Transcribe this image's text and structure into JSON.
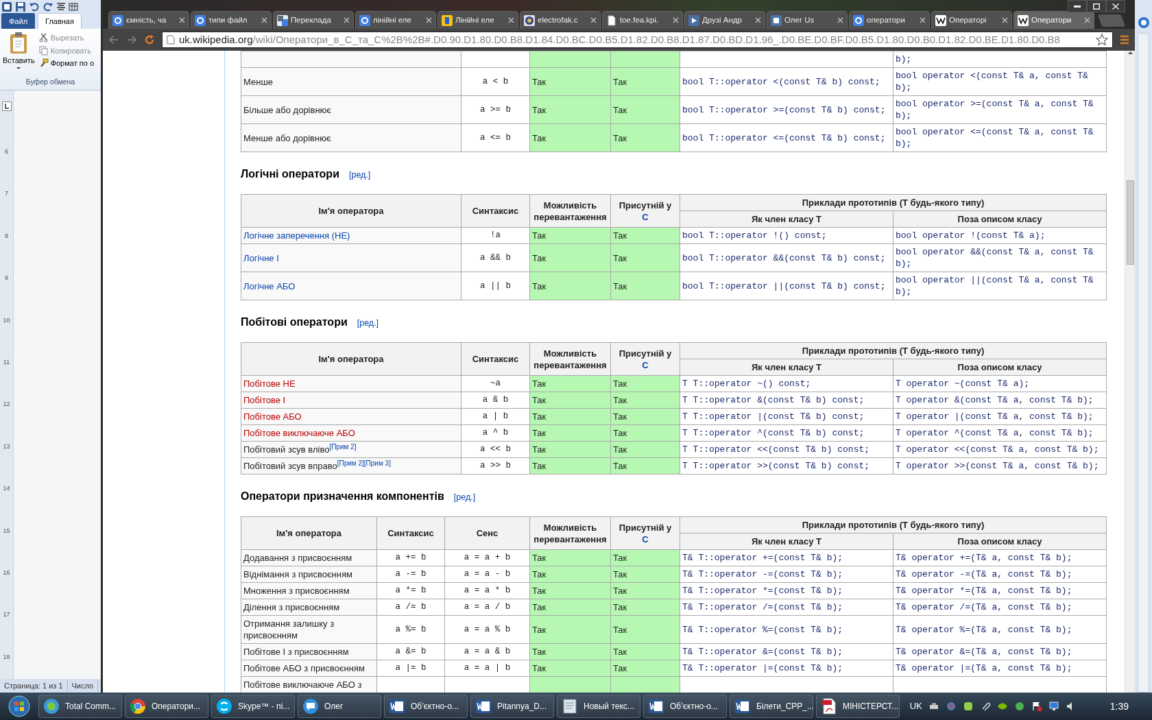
{
  "word": {
    "tabs": [
      {
        "label": "Файл",
        "kind": "file",
        "selected": false
      },
      {
        "label": "Главная",
        "kind": "tab",
        "selected": true
      }
    ],
    "clipboard": {
      "paste": "Вставить",
      "group": "Буфер обмена",
      "items": [
        {
          "label": "Вырезать",
          "kind": "cut",
          "disabled": true
        },
        {
          "label": "Копировать",
          "kind": "copy",
          "disabled": true
        },
        {
          "label": "Формат по о",
          "kind": "format",
          "disabled": false
        }
      ]
    },
    "ruler": [
      "6",
      "7",
      "8",
      "9",
      "10",
      "11",
      "12",
      "13",
      "14",
      "15",
      "16",
      "17",
      "18"
    ],
    "status_bar": [
      "Страница: 1 из 1",
      "Число"
    ]
  },
  "browser": {
    "tabs": [
      {
        "title": "ємність, ча",
        "selected": false
      },
      {
        "title": "типи файл",
        "selected": false
      },
      {
        "title": "Переклада",
        "selected": false
      },
      {
        "title": "лінійні еле",
        "selected": false
      },
      {
        "title": "Лінійні еле",
        "selected": false
      },
      {
        "title": "electrofak.c",
        "selected": false
      },
      {
        "title": "toe.fea.kpi.",
        "selected": false
      },
      {
        "title": "Друзі Андр",
        "selected": false
      },
      {
        "title": "Олег Us",
        "selected": false
      },
      {
        "title": "оператори",
        "selected": false
      },
      {
        "title": "Операторі",
        "selected": false
      },
      {
        "title": "Оператори",
        "selected": true
      }
    ],
    "address": {
      "host": "uk.wikipedia.org",
      "path": "/wiki/Оператори_в_C_та_C%2B%2B#.D0.90.D1.80.D0.B8.D1.84.D0.BC.D0.B5.D1.82.D0.B8.D1.87.D0.BD.D1.96_.D0.BE.D0.BF.D0.B5.D1.80.D0.B0.D1.82.D0.BE.D1.80.D0.B8"
    }
  },
  "page": {
    "sections": [
      {
        "rows": [
          {
            "nonmember": "b);"
          },
          {
            "name": {
              "text": "Менше",
              "kind": "text"
            },
            "syntax": "a < b",
            "overload": "Так",
            "in_c": "Так",
            "member": "bool T::operator <(const T& b) const;",
            "nonmember": "bool operator <(const T& a, const T& b);"
          },
          {
            "name": {
              "text": "Більше або дорівнює",
              "kind": "text"
            },
            "syntax": "a >= b",
            "overload": "Так",
            "in_c": "Так",
            "member": "bool T::operator >=(const T& b) const;",
            "nonmember": "bool operator >=(const T& a, const T& b);"
          },
          {
            "name": {
              "text": "Менше або дорівнює",
              "kind": "text"
            },
            "syntax": "a <= b",
            "overload": "Так",
            "in_c": "Так",
            "member": "bool T::operator <=(const T& b) const;",
            "nonmember": "bool operator <=(const T& a, const T& b);"
          }
        ]
      },
      {
        "heading": "Логічні оператори",
        "edit": "[ред.]",
        "header": {
          "name": "Ім'я оператора",
          "syntax": "Синтаксис",
          "overload": "Можливість перевантаження",
          "in_c": "Присутній у",
          "in_c_link": "C",
          "group": "Приклади прототипів (T будь-якого типу)",
          "member": "Як член класу T",
          "nonmember": "Поза описом класу"
        },
        "rows": [
          {
            "name": {
              "text": "Логічне заперечення (НЕ)",
              "kind": "link"
            },
            "syntax": "!a",
            "overload": "Так",
            "in_c": "Так",
            "member": "bool T::operator !() const;",
            "nonmember": "bool operator !(const T& a);"
          },
          {
            "name": {
              "text": "Логічне І",
              "kind": "link"
            },
            "syntax": "a && b",
            "overload": "Так",
            "in_c": "Так",
            "member": "bool T::operator &&(const T& b) const;",
            "nonmember": "bool operator &&(const T& a, const T& b);"
          },
          {
            "name": {
              "text": "Логічне АБО",
              "kind": "link"
            },
            "syntax": "a || b",
            "overload": "Так",
            "in_c": "Так",
            "member": "bool T::operator ||(const T& b) const;",
            "nonmember": "bool operator ||(const T& a, const T& b);"
          }
        ]
      },
      {
        "heading": "Побітові оператори",
        "edit": "[ред.]",
        "header": {
          "name": "Ім'я оператора",
          "syntax": "Синтаксис",
          "overload": "Можливість перевантаження",
          "in_c": "Присутній у",
          "in_c_link": "C",
          "group": "Приклади прототипів (T будь-якого типу)",
          "member": "Як член класу T",
          "nonmember": "Поза описом класу"
        },
        "rows": [
          {
            "name": {
              "text": "Побітове НЕ",
              "kind": "redlink"
            },
            "syntax": "~a",
            "overload": "Так",
            "in_c": "Так",
            "member": "T T::operator ~() const;",
            "nonmember": "T operator ~(const T& a);"
          },
          {
            "name": {
              "text": "Побітове І",
              "kind": "redlink"
            },
            "syntax": "a & b",
            "overload": "Так",
            "in_c": "Так",
            "member": "T T::operator &(const T& b) const;",
            "nonmember": "T operator &(const T& a, const T& b);"
          },
          {
            "name": {
              "text": "Побітове АБО",
              "kind": "redlink"
            },
            "syntax": "a | b",
            "overload": "Так",
            "in_c": "Так",
            "member": "T T::operator |(const T& b) const;",
            "nonmember": "T operator |(const T& a, const T& b);"
          },
          {
            "name": {
              "text": "Побітове виключаюче АБО",
              "kind": "redlink"
            },
            "syntax": "a ^ b",
            "overload": "Так",
            "in_c": "Так",
            "member": "T T::operator ^(const T& b) const;",
            "nonmember": "T operator ^(const T& a, const T& b);"
          },
          {
            "name": {
              "text": "Побітовий зсув вліво",
              "kind": "text",
              "notes": [
                "[Прим 2]"
              ]
            },
            "syntax": "a << b",
            "overload": "Так",
            "in_c": "Так",
            "member": "T T::operator <<(const T& b) const;",
            "nonmember": "T operator <<(const T& a, const T& b);"
          },
          {
            "name": {
              "text": "Побітовий зсув вправо",
              "kind": "text",
              "notes": [
                "[Прим 2]",
                "[Прим 3]"
              ]
            },
            "syntax": "a >> b",
            "overload": "Так",
            "in_c": "Так",
            "member": "T T::operator >>(const T& b) const;",
            "nonmember": "T operator >>(const T& a, const T& b);"
          }
        ]
      },
      {
        "heading": "Оператори призначення компонентів",
        "edit": "[ред.]",
        "header": {
          "name": "Ім'я оператора",
          "syntax": "Синтаксис",
          "sense": "Сенс",
          "overload": "Можливість перевантаження",
          "in_c": "Присутній у",
          "in_c_link": "C",
          "group": "Приклади прототипів (T будь-якого типу)",
          "member": "Як член класу T",
          "nonmember": "Поза описом класу"
        },
        "rows": [
          {
            "name": {
              "text": "Додавання з присвоєнням",
              "kind": "text"
            },
            "syntax": "a += b",
            "sense": "a = a + b",
            "overload": "Так",
            "in_c": "Так",
            "member": "T& T::operator +=(const T& b);",
            "nonmember": "T& operator +=(T& a, const T& b);"
          },
          {
            "name": {
              "text": "Віднімання з присвоєнням",
              "kind": "text"
            },
            "syntax": "a -= b",
            "sense": "a = a - b",
            "overload": "Так",
            "in_c": "Так",
            "member": "T& T::operator -=(const T& b);",
            "nonmember": "T& operator -=(T& a, const T& b);"
          },
          {
            "name": {
              "text": "Множення з присвоєнням",
              "kind": "text"
            },
            "syntax": "a *= b",
            "sense": "a = a * b",
            "overload": "Так",
            "in_c": "Так",
            "member": "T& T::operator *=(const T& b);",
            "nonmember": "T& operator *=(T& a, const T& b);"
          },
          {
            "name": {
              "text": "Ділення з присвоєнням",
              "kind": "text"
            },
            "syntax": "a /= b",
            "sense": "a = a / b",
            "overload": "Так",
            "in_c": "Так",
            "member": "T& T::operator /=(const T& b);",
            "nonmember": "T& operator /=(T& a, const T& b);"
          },
          {
            "name": {
              "text": "Отримання залишку з присвоєнням",
              "kind": "text"
            },
            "syntax": "a %= b",
            "sense": "a = a % b",
            "overload": "Так",
            "in_c": "Так",
            "member": "T& T::operator %=(const T& b);",
            "nonmember": "T& operator %=(T& a, const T& b);"
          },
          {
            "name": {
              "text": "Побітове І з присвоєнням",
              "kind": "text"
            },
            "syntax": "a &= b",
            "sense": "a = a & b",
            "overload": "Так",
            "in_c": "Так",
            "member": "T& T::operator &=(const T& b);",
            "nonmember": "T& operator &=(T& a, const T& b);"
          },
          {
            "name": {
              "text": "Побітове АБО з присвоєнням",
              "kind": "text"
            },
            "syntax": "a |= b",
            "sense": "a = a | b",
            "overload": "Так",
            "in_c": "Так",
            "member": "T& T::operator |=(const T& b);",
            "nonmember": "T& operator |=(T& a, const T& b);"
          },
          {
            "name": {
              "text": "Побітове виключаюче АБО з",
              "kind": "text"
            }
          }
        ]
      }
    ]
  },
  "taskbar": {
    "items": [
      {
        "label": "Total Comm..."
      },
      {
        "label": "Оператори..."
      },
      {
        "label": "Skype™ - ni..."
      },
      {
        "label": "Олег"
      },
      {
        "label": "Об’єктно-о..."
      },
      {
        "label": "Pitannya_D..."
      },
      {
        "label": "Новый текс..."
      },
      {
        "label": "Об’єктно-о..."
      },
      {
        "label": "Білети_CPP_..."
      },
      {
        "label": "МІНІСТЕРСТ..."
      }
    ],
    "language": "UK",
    "time": "1:39"
  }
}
